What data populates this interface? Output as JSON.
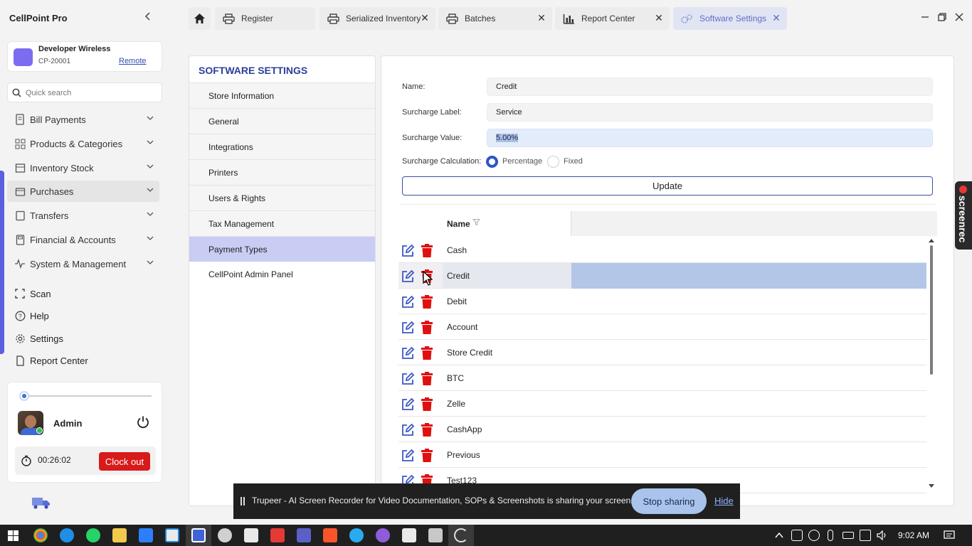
{
  "app": {
    "title": "CellPoint Pro"
  },
  "store": {
    "name": "Developer Wireless",
    "code": "CP-20001",
    "remote_label": "Remote"
  },
  "search": {
    "placeholder": "Quick search"
  },
  "nav": {
    "groups": [
      {
        "label": "Bill Payments",
        "icon": "receipt-icon"
      },
      {
        "label": "Products & Categories",
        "icon": "grid-icon"
      },
      {
        "label": "Inventory Stock",
        "icon": "box-icon"
      },
      {
        "label": "Purchases",
        "icon": "cart-icon"
      },
      {
        "label": "Transfers",
        "icon": "transfer-icon"
      },
      {
        "label": "Financial & Accounts",
        "icon": "calculator-icon"
      },
      {
        "label": "System & Management",
        "icon": "pulse-icon"
      }
    ],
    "links": [
      {
        "label": "Scan",
        "icon": "scan-icon"
      },
      {
        "label": "Help",
        "icon": "help-icon"
      },
      {
        "label": "Settings",
        "icon": "gear-icon"
      },
      {
        "label": "Report Center",
        "icon": "document-icon"
      }
    ]
  },
  "user": {
    "name": "Admin",
    "timer": "00:26:02",
    "clock_out_label": "Clock out"
  },
  "tabs": [
    {
      "label": "Register",
      "icon": "printer-icon"
    },
    {
      "label": "Serialized Inventory",
      "icon": "printer-icon"
    },
    {
      "label": "Batches",
      "icon": "printer-icon"
    },
    {
      "label": "Report Center",
      "icon": "bar-chart-icon"
    },
    {
      "label": "Software Settings",
      "icon": "gears-icon"
    }
  ],
  "settings_menu": {
    "heading": "SOFTWARE SETTINGS",
    "items": [
      "Store Information",
      "General",
      "Integrations",
      "Printers",
      "Users & Rights",
      "Tax Management",
      "Payment Types",
      "CellPoint Admin Panel"
    ],
    "selected": "Payment Types"
  },
  "form": {
    "name_label": "Name:",
    "name_value": "Credit",
    "surcharge_label_label": "Surcharge Label:",
    "surcharge_label_value": "Service",
    "surcharge_value_label": "Surcharge Value:",
    "surcharge_value_value": "5.00%",
    "calc_label": "Surcharge Calculation:",
    "calc_options": [
      "Percentage",
      "Fixed"
    ],
    "calc_selected": "Percentage",
    "update_label": "Update"
  },
  "grid": {
    "column_header": "Name",
    "rows": [
      "Cash",
      "Credit",
      "Debit",
      "Account",
      "Store Credit",
      "BTC",
      "Zelle",
      "CashApp",
      "Previous",
      "Test123"
    ],
    "selected_row": "Credit"
  },
  "screenrec": {
    "label": "screenrec"
  },
  "share_banner": {
    "message": "Trupeer - AI Screen Recorder for Video Documentation, SOPs & Screenshots is sharing your screen.",
    "stop_label": "Stop sharing",
    "hide_label": "Hide"
  },
  "taskbar": {
    "time": "9:02 AM"
  },
  "colors": {
    "accent": "#2c3f9a",
    "selected_menu": "#c9ccf3",
    "delete_red": "#e01010",
    "edit_blue": "#3b58c4",
    "clock_out_red": "#d81a1a"
  }
}
